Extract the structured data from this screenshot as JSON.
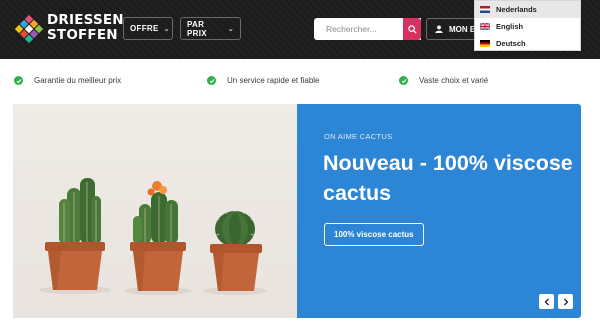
{
  "header": {
    "brand_line1": "DRIESSEN",
    "brand_line2": "STOFFEN",
    "nav": [
      {
        "label": "OFFRE"
      },
      {
        "label": "PAR PRIX"
      }
    ],
    "search_placeholder": "Rechercher...",
    "account_label": "MON E"
  },
  "language_menu": {
    "items": [
      {
        "label": "Nederlands",
        "flag": "flag-nl-icon",
        "active": true
      },
      {
        "label": "English",
        "flag": "flag-uk-icon",
        "active": false
      },
      {
        "label": "Deutsch",
        "flag": "flag-de-icon",
        "active": false
      }
    ]
  },
  "usps": [
    {
      "text": "Garantie du meilleur prix"
    },
    {
      "text": "Un service rapide et fiable"
    },
    {
      "text": "Vaste choix et varié"
    }
  ],
  "hero": {
    "eyebrow": "ON AIME CACTUS",
    "title": "Nouveau - 100% viscose cactus",
    "cta_label": "100% viscose cactus"
  },
  "colors": {
    "header_bg": "#1c1c1c",
    "search_button": "#d63160",
    "hero_panel": "#2c86d5",
    "check": "#2bb24c"
  }
}
